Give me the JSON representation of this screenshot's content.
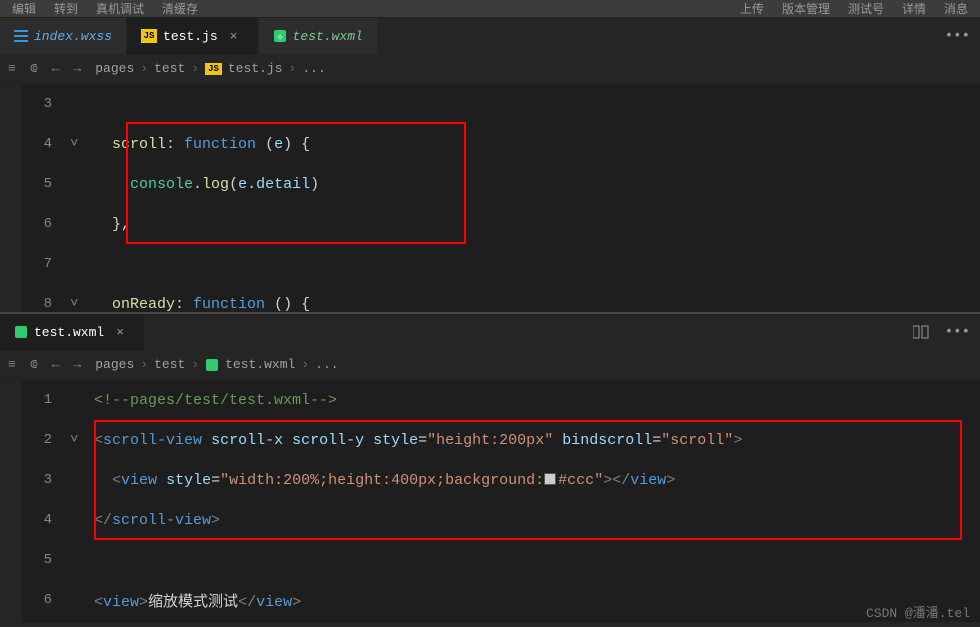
{
  "menu": {
    "left": [
      "编辑",
      "转到",
      "真机调试",
      "清缓存"
    ],
    "right": [
      "上传",
      "版本管理",
      "测试号",
      "详情",
      "消息"
    ]
  },
  "pane1": {
    "tabs": [
      {
        "icon": "wxss",
        "label": "index.wxss",
        "active": false
      },
      {
        "icon": "js",
        "label": "test.js",
        "active": true
      },
      {
        "icon": "wxml",
        "label": "test.wxml",
        "active": false
      }
    ],
    "breadcrumb": [
      "pages",
      "test",
      "test.js",
      "..."
    ],
    "lines": {
      "l3_no": "3",
      "l4_no": "4",
      "l5_no": "5",
      "l6_no": "6",
      "l7_no": "7",
      "l8_no": "8",
      "scroll_name": "scroll",
      "colon1": ": ",
      "func_kw": "function",
      "paren_open": " (",
      "param_e": "e",
      "paren_close_brace": ") {",
      "console": "console",
      "dot": ".",
      "log": "log",
      "lparen": "(",
      "e2": "e",
      "dot2": ".",
      "detail": "detail",
      "rparen": ")",
      "close_brace_comma": "},",
      "onReady": "onReady",
      "colon2": ": ",
      "func_kw2": "function",
      "noparam": " () {"
    }
  },
  "pane2": {
    "tabs": [
      {
        "icon": "wxml",
        "label": "test.wxml",
        "active": true
      }
    ],
    "breadcrumb": [
      "pages",
      "test",
      "test.wxml",
      "..."
    ],
    "lines": {
      "n1": "1",
      "n2": "2",
      "n3": "3",
      "n4": "4",
      "n5": "5",
      "n6": "6",
      "cmt_open": "<!--",
      "cmt_body": "pages/test/test.wxml",
      "cmt_close": "-->",
      "sv_open": "<",
      "sv_tag": "scroll-view",
      "sv_sp": " ",
      "attr_sx": "scroll-x",
      "attr_sy": "scroll-y",
      "attr_style": "style",
      "eq": "=",
      "q": "\"",
      "style_val": "height:200px",
      "attr_bind": "bindscroll",
      "bind_val": "scroll",
      "gt": ">",
      "view_open": "<",
      "view_tag": "view",
      "view_style_val": "width:200%;height:400px;background:",
      "ccc": "#ccc",
      "view_close_tag": "></",
      "view_tag2": "view",
      "sv_close_open": "</",
      "sv_tag2": "scroll-view",
      "view2_txt": "缩放模式测试",
      "view2_open": "<",
      "view2_tag": "view",
      "view2_close": "</",
      "view2_tag2": "view"
    }
  },
  "watermark": "CSDN @潘潘.tel"
}
